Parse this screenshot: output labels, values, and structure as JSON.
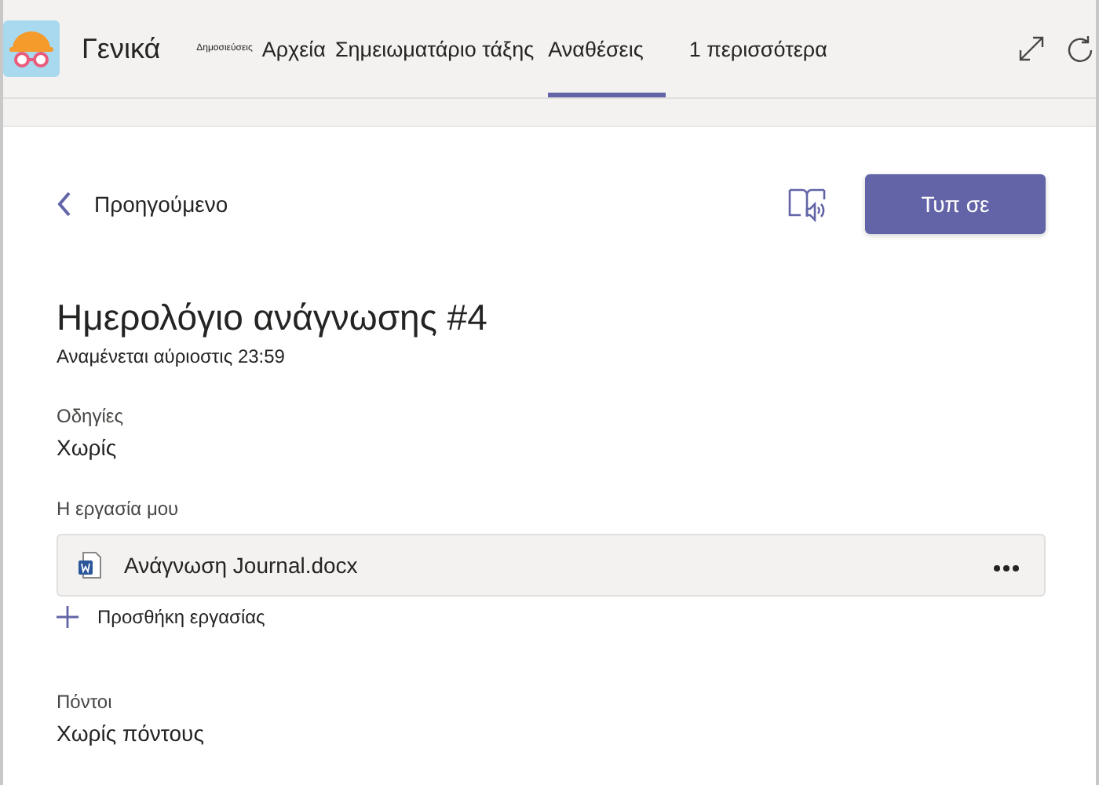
{
  "header": {
    "team_name": "Γενικά",
    "tabs": [
      {
        "label": "Δημοσιεύσεις",
        "kind": "tiny",
        "selected": false
      },
      {
        "label": "Αρχεία",
        "kind": "normal",
        "selected": false
      },
      {
        "label": "Σημειωματάριο τάξης",
        "kind": "normal",
        "selected": false
      },
      {
        "label": "Αναθέσεις",
        "kind": "normal",
        "selected": true
      },
      {
        "label": "1 περισσότερα",
        "kind": "more",
        "selected": false
      }
    ]
  },
  "back": {
    "label": "Προηγούμενο"
  },
  "turn_in_button": "Τυπ σε",
  "assignment": {
    "title": "Ημερολόγιο ανάγνωσης #4",
    "due": "Αναμένεται αύριοστις 23:59"
  },
  "instructions": {
    "label": "Οδηγίες",
    "value": "Χωρίς"
  },
  "my_work": {
    "label": "Η εργασία μου",
    "files": [
      {
        "name": "Ανάγνωση Journal.docx"
      }
    ],
    "add_label": "Προσθήκη εργασίας"
  },
  "points": {
    "label": "Πόντοι",
    "value": "Χωρίς πόντους"
  }
}
